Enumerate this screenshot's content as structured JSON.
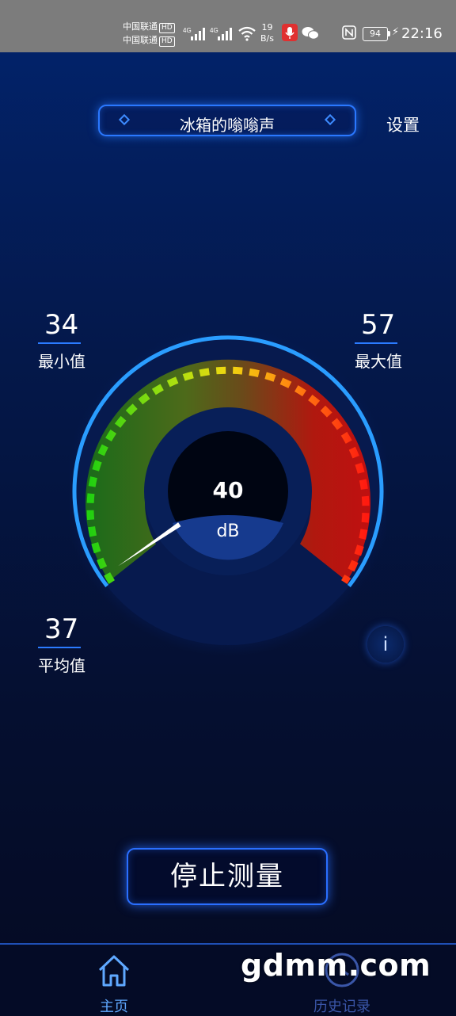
{
  "status_bar": {
    "carrier_1": "中国联通",
    "carrier_2": "中国联通",
    "hd_badge": "HD",
    "net_type": "4G",
    "speed_value": "19",
    "speed_unit": "B/s",
    "battery": "94",
    "time": "22:16"
  },
  "header": {
    "title": "冰箱的嗡嗡声",
    "settings_label": "设置"
  },
  "stats": {
    "min": {
      "value": "34",
      "label": "最小值"
    },
    "max": {
      "value": "57",
      "label": "最大值"
    },
    "avg": {
      "value": "37",
      "label": "平均值"
    }
  },
  "gauge": {
    "reading": "40",
    "unit": "dB",
    "level": 0.04
  },
  "info_button": {
    "label": "i"
  },
  "stop_button": {
    "label": "停止测量"
  },
  "nav": {
    "home_label": "主页",
    "history_label": "历史记录"
  },
  "watermark": "gdmm.com",
  "colors": {
    "accent": "#2a78ff",
    "home_active": "#5fa8ff",
    "history_inactive": "#3a56a8"
  }
}
